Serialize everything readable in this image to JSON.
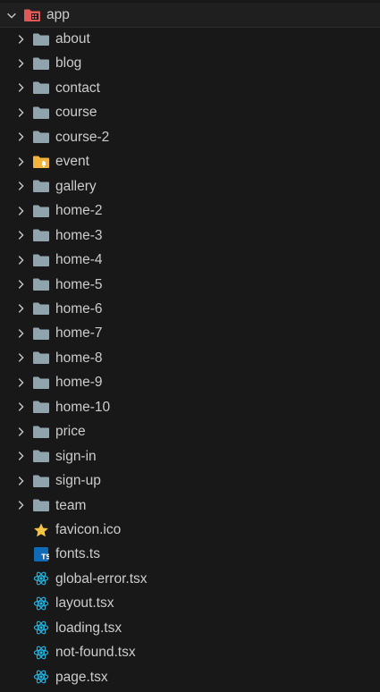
{
  "explorer": {
    "root": {
      "label": "app",
      "expanded": true,
      "icon": "folder-app-icon"
    },
    "folders": [
      {
        "label": "about",
        "icon": "folder-icon"
      },
      {
        "label": "blog",
        "icon": "folder-icon"
      },
      {
        "label": "contact",
        "icon": "folder-icon"
      },
      {
        "label": "course",
        "icon": "folder-icon"
      },
      {
        "label": "course-2",
        "icon": "folder-icon"
      },
      {
        "label": "event",
        "icon": "folder-event-icon"
      },
      {
        "label": "gallery",
        "icon": "folder-icon"
      },
      {
        "label": "home-2",
        "icon": "folder-icon"
      },
      {
        "label": "home-3",
        "icon": "folder-icon"
      },
      {
        "label": "home-4",
        "icon": "folder-icon"
      },
      {
        "label": "home-5",
        "icon": "folder-icon"
      },
      {
        "label": "home-6",
        "icon": "folder-icon"
      },
      {
        "label": "home-7",
        "icon": "folder-icon"
      },
      {
        "label": "home-8",
        "icon": "folder-icon"
      },
      {
        "label": "home-9",
        "icon": "folder-icon"
      },
      {
        "label": "home-10",
        "icon": "folder-icon"
      },
      {
        "label": "price",
        "icon": "folder-icon"
      },
      {
        "label": "sign-in",
        "icon": "folder-icon"
      },
      {
        "label": "sign-up",
        "icon": "folder-icon"
      },
      {
        "label": "team",
        "icon": "folder-icon"
      }
    ],
    "files": [
      {
        "label": "favicon.ico",
        "icon": "star-icon"
      },
      {
        "label": "fonts.ts",
        "icon": "typescript-icon"
      },
      {
        "label": "global-error.tsx",
        "icon": "react-icon"
      },
      {
        "label": "layout.tsx",
        "icon": "react-icon"
      },
      {
        "label": "loading.tsx",
        "icon": "react-icon"
      },
      {
        "label": "not-found.tsx",
        "icon": "react-icon"
      },
      {
        "label": "page.tsx",
        "icon": "react-icon"
      }
    ]
  },
  "colors": {
    "background": "#181818",
    "text": "#cccccc",
    "folder": "#90a4ae",
    "app_folder": "#e05a5a",
    "event_folder": "#f2b33d",
    "react": "#22b8e6",
    "typescript": "#0f6ab8",
    "favicon": "#f6c443"
  }
}
